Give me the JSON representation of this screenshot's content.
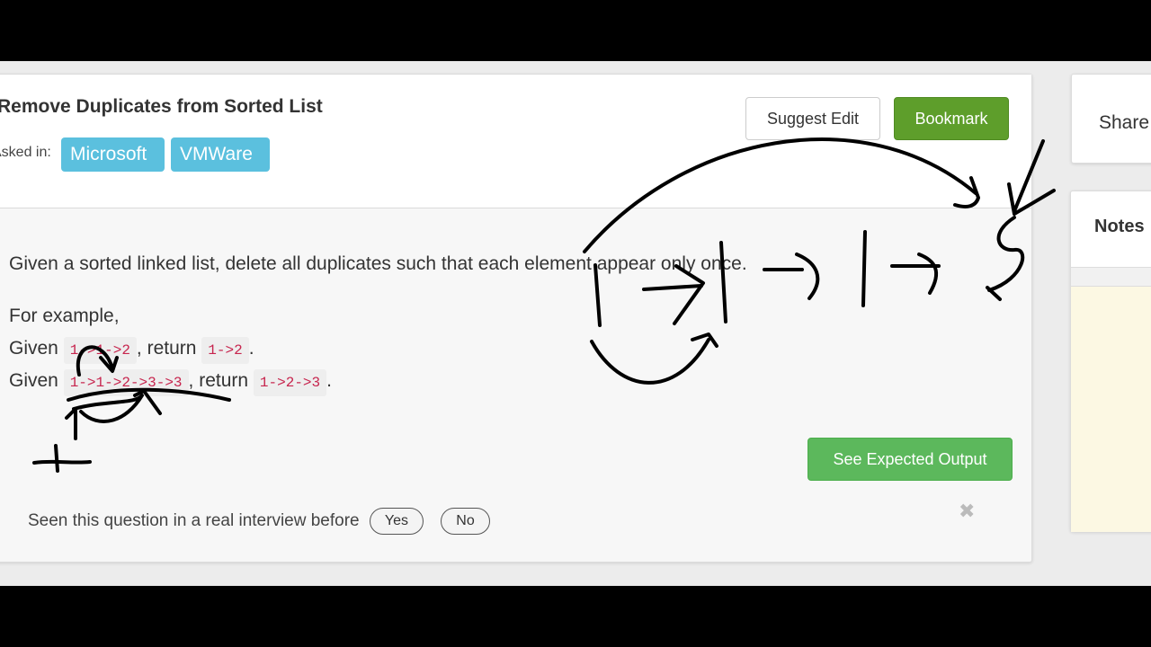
{
  "problem": {
    "title": "Remove Duplicates from Sorted List",
    "asked_in_label": "Asked in:",
    "companies": [
      "Microsoft",
      "VMWare"
    ],
    "description": "Given a sorted linked list, delete all duplicates such that each element appear only once.",
    "example_heading": "For example,",
    "examples": [
      {
        "given_label": "Given",
        "input": "1->1->2",
        "return_label": ", return",
        "output": "1->2",
        "end": "."
      },
      {
        "given_label": "Given",
        "input": "1->1->2->3->3",
        "return_label": ", return",
        "output": "1->2->3",
        "end": "."
      }
    ]
  },
  "actions": {
    "suggest_edit": "Suggest Edit",
    "bookmark": "Bookmark",
    "see_expected_output": "See Expected Output"
  },
  "feedback": {
    "question": "Seen this question in a real interview before",
    "yes": "Yes",
    "no": "No",
    "close": "✖"
  },
  "sidebar": {
    "share": "Share",
    "notes": "Notes"
  },
  "colors": {
    "tag": "#5bc0de",
    "bookmark": "#5e9e2b",
    "output": "#5cb85c",
    "code_text": "#c7254e",
    "notes_bg": "#fcf8e3"
  }
}
